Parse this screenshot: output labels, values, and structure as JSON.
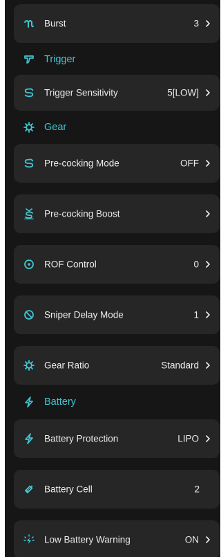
{
  "accent_color": "#3ec7d4",
  "rows_top": [
    {
      "label": "Burst",
      "value": "3",
      "icon": "burst-icon",
      "chevron": true
    }
  ],
  "sections": {
    "trigger": {
      "title": "Trigger",
      "icon": "trigger-icon"
    },
    "gear": {
      "title": "Gear",
      "icon": "gear-icon"
    },
    "battery": {
      "title": "Battery",
      "icon": "lightning-icon"
    }
  },
  "trigger_rows": [
    {
      "label": "Trigger Sensitivity",
      "value": "5[LOW]",
      "icon": "s-curve-icon"
    }
  ],
  "gear_rows": [
    {
      "label": "Pre-cocking Mode",
      "value": "OFF",
      "icon": "s-curve-icon"
    },
    {
      "label": "Pre-cocking Boost",
      "value": "",
      "icon": "boost-icon"
    },
    {
      "label": "ROF Control",
      "value": "0",
      "icon": "target-icon"
    },
    {
      "label": "Sniper Delay Mode",
      "value": "1",
      "icon": "prohibited-icon"
    },
    {
      "label": "Gear Ratio",
      "value": "Standard",
      "icon": "gear-icon"
    }
  ],
  "battery_rows": [
    {
      "label": "Battery Protection",
      "value": "LIPO",
      "icon": "lightning-icon"
    },
    {
      "label": "Battery Cell",
      "value": "2",
      "icon": "battery-cell-icon"
    },
    {
      "label": "Low Battery Warning",
      "value": "ON",
      "icon": "battery-warning-icon"
    }
  ]
}
